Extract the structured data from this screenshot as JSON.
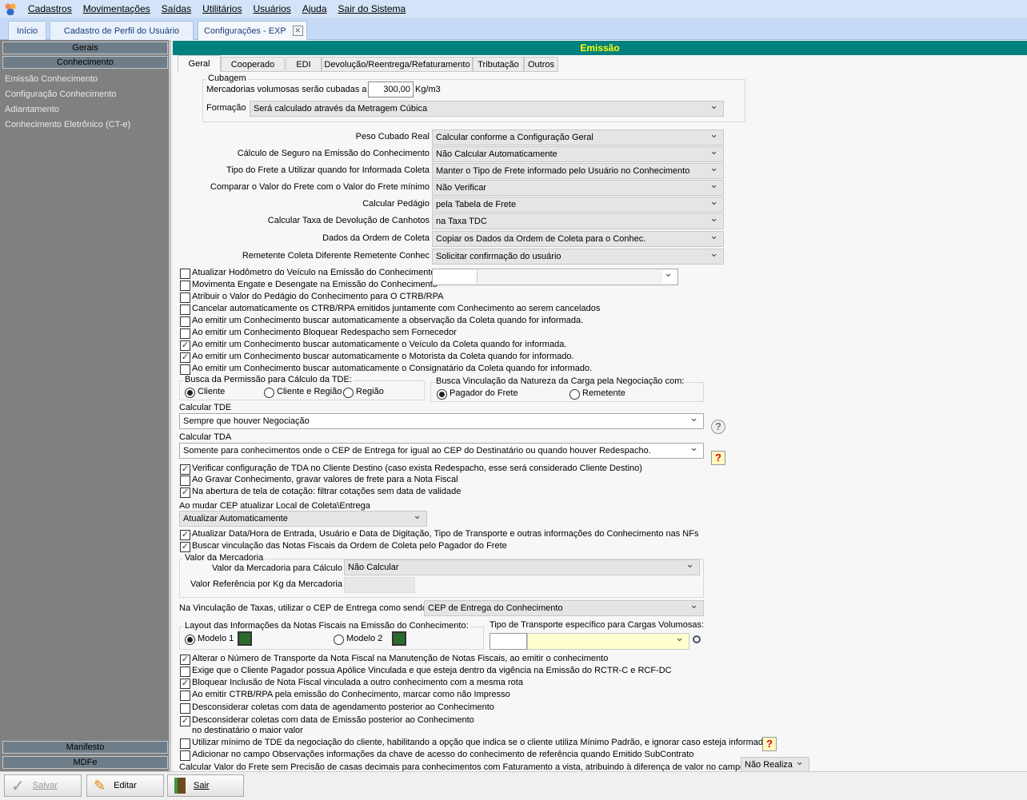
{
  "menu": [
    "Cadastros",
    "Movimentações",
    "Saídas",
    "Utilitários",
    "Usuários",
    "Ajuda",
    "Sair do Sistema"
  ],
  "window_tabs": [
    "Início",
    "Cadastro de Perfil do Usuário",
    "Configurações - EXP"
  ],
  "sidebar": {
    "gerais": "Gerais",
    "conhecimento": "Conhecimento",
    "items": [
      "Emissão Conhecimento",
      "Configuração Conhecimento",
      "Adiantamento",
      "Conhecimento Eletrônico (CT-e)"
    ],
    "manifesto": "Manifesto",
    "mdfe": "MDFe"
  },
  "header_title": "Emissão",
  "page_tabs": [
    "Geral",
    "Cooperado",
    "EDI",
    "Devolução/Reentrega/Refaturamento",
    "Tributação",
    "Outros"
  ],
  "cubagem": {
    "legend": "Cubagem",
    "label": "Mercadorias volumosas serão cubadas a",
    "value": "300,00",
    "unit": "Kg/m3",
    "formacao_label": "Formação",
    "formacao_value": "Será calculado através da Metragem Cúbica"
  },
  "settings": [
    {
      "label": "Peso Cubado Real",
      "value": "Calcular conforme a Configuração Geral"
    },
    {
      "label": "Cálculo de Seguro na Emissão do Conhecimento",
      "value": "Não Calcular Automaticamente"
    },
    {
      "label": "Tipo do Frete a Utilizar quando for Informada Coleta",
      "value": "Manter o Tipo de Frete informado pelo Usuário no Conhecimento"
    },
    {
      "label": "Comparar o Valor do Frete com o Valor do Frete mínimo",
      "value": "Não Verificar"
    },
    {
      "label": "Calcular Pedágio",
      "value": "pela Tabela de Frete"
    },
    {
      "label": "Calcular Taxa de Devolução de Canhotos",
      "value": "na Taxa TDC"
    },
    {
      "label": "Dados da Ordem de Coleta",
      "value": "Copiar os Dados da Ordem de Coleta para o Conhec."
    },
    {
      "label": "Remetente Coleta Diferente Remetente Conhec",
      "value": "Solicitar confirmação do usuário"
    }
  ],
  "checks1": [
    {
      "label": "Atualizar Hodômetro do Veículo na Emissão do Conhecimento",
      "checked": false
    },
    {
      "label": "Movimenta Engate e Desengate na Emissão do Conhecimento",
      "checked": false
    },
    {
      "label": "Atribuir o Valor do Pedágio do Conhecimento para O CTRB/RPA",
      "checked": false
    },
    {
      "label": "Cancelar automaticamente os CTRB/RPA emitidos juntamente com Conhecimento ao serem cancelados",
      "checked": false
    },
    {
      "label": "Ao emitir um Conhecimento buscar automaticamente a observação da Coleta quando for informada.",
      "checked": false
    },
    {
      "label": "Ao emitir um Conhecimento Bloquear Redespacho sem Fornecedor",
      "checked": false
    },
    {
      "label": "Ao emitir um Conhecimento buscar automaticamente o Veículo da Coleta quando for informada.",
      "checked": true
    },
    {
      "label": "Ao emitir um Conhecimento buscar automaticamente o Motorista da Coleta quando for informado.",
      "checked": true
    },
    {
      "label": "Ao emitir um Conhecimento buscar automaticamente o Consignatário da Coleta quando for informado.",
      "checked": false
    }
  ],
  "permissao": {
    "legend": "Busca da Permissão para Cálculo da TDE:",
    "options": [
      "Cliente",
      "Cliente e Região",
      "Região"
    ],
    "selected": 0
  },
  "natureza": {
    "legend": "Busca Vinculação da Natureza da Carga pela Negociação com:",
    "options": [
      "Pagador do Frete",
      "Remetente"
    ],
    "selected": 0
  },
  "tde": {
    "label": "Calcular TDE",
    "value": "Sempre que houver Negociação"
  },
  "tda": {
    "label": "Calcular TDA",
    "value": "Somente para conhecimentos onde o CEP de Entrega for igual ao CEP do Destinatário ou quando houver Redespacho."
  },
  "checks2": [
    {
      "label": "Verificar configuração de TDA no Cliente Destino (caso exista Redespacho, esse será considerado Cliente Destino)",
      "checked": true
    },
    {
      "label": "Ao Gravar Conhecimento, gravar valores de frete para a Nota Fiscal",
      "checked": false
    },
    {
      "label": "Na abertura de tela de cotação: filtrar cotações sem data de validade",
      "checked": true
    }
  ],
  "cep": {
    "label": "Ao mudar CEP atualizar Local de Coleta\\Entrega",
    "value": "Atualizar Automaticamente"
  },
  "checks3": [
    {
      "label": "Atualizar Data/Hora de Entrada, Usuário e Data de Digitação, Tipo de Transporte e outras informações do Conhecimento nas NFs",
      "checked": true
    },
    {
      "label": "Buscar vinculação das Notas Fiscais da Ordem de  Coleta pelo Pagador do Frete",
      "checked": true
    }
  ],
  "mercadoria": {
    "legend": "Valor da Mercadoria",
    "calc_label": "Valor da Mercadoria para Cálculo",
    "calc_value": "Não Calcular",
    "ref_label": "Valor Referência por Kg da Mercadoria",
    "ref_value": ""
  },
  "taxas": {
    "label": "Na Vinculação de Taxas, utilizar o CEP de Entrega como sendo:",
    "value": "CEP de Entrega do Conhecimento"
  },
  "layout_nf": {
    "legend": "Layout das Informações da Notas Fiscais na Emissão do Conhecimento:",
    "options": [
      "Modelo 1",
      "Modelo 2"
    ],
    "selected": 0
  },
  "transporte": {
    "label": "Tipo de Transporte específico para Cargas Volumosas:",
    "code": "",
    "value": ""
  },
  "checks4": [
    {
      "label": "Alterar o Número de Transporte da Nota Fiscal na Manutenção de Notas Fiscais, ao emitir o conhecimento",
      "checked": true
    },
    {
      "label": "Exige que o Cliente Pagador possua Apólice Vinculada e que esteja dentro da vigência na Emissão do RCTR-C e RCF-DC",
      "checked": false
    },
    {
      "label": "Bloquear Inclusão de Nota Fiscal vinculada a outro conhecimento com a mesma rota",
      "checked": true
    },
    {
      "label": "Ao emitir CTRB/RPA pela emissão do Conhecimento, marcar como não Impresso",
      "checked": false
    },
    {
      "label": "Desconsiderar coletas com data de agendamento posterior ao Conhecimento",
      "checked": false
    },
    {
      "label": "Desconsiderar coletas com data de Emissão posterior ao Conhecimento",
      "checked": true
    },
    {
      "label": "Utilizar mínimo de TDE da negociação do cliente, habilitando a opção que indica se o cliente utiliza Mínimo Padrão, e ignorar caso esteja informado",
      "checked": false
    },
    {
      "label": "Adicionar no campo Observações informações da chave de acesso do conhecimento de referência quando Emitido  SubContrato",
      "checked": false
    }
  ],
  "check_note": "no destinatário o maior valor",
  "precisao": {
    "label": "Calcular Valor do Frete sem Precisão de casas decimais para conhecimentos com Faturamento a vista, atribuindo à diferença de valor no campo",
    "value": "Não Realiza"
  },
  "toolbar": {
    "save": "Salvar",
    "edit": "Editar",
    "exit": "Sair"
  }
}
